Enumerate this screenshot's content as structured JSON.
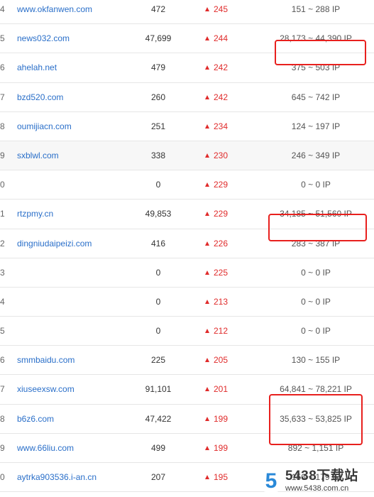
{
  "rows": [
    {
      "rank": "4",
      "domain": "www.okfanwen.com",
      "count": "472",
      "change": "245",
      "ip": "151 ~ 288 IP"
    },
    {
      "rank": "5",
      "domain": "news032.com",
      "count": "47,699",
      "change": "244",
      "ip": "28,173 ~ 44,390 IP"
    },
    {
      "rank": "6",
      "domain": "ahelah.net",
      "count": "479",
      "change": "242",
      "ip": "375 ~ 503 IP"
    },
    {
      "rank": "7",
      "domain": "bzd520.com",
      "count": "260",
      "change": "242",
      "ip": "645 ~ 742 IP"
    },
    {
      "rank": "8",
      "domain": "oumijiacn.com",
      "count": "251",
      "change": "234",
      "ip": "124 ~ 197 IP"
    },
    {
      "rank": "9",
      "domain": "sxblwl.com",
      "count": "338",
      "change": "230",
      "ip": "246 ~ 349 IP"
    },
    {
      "rank": "0",
      "domain": "",
      "count": "0",
      "change": "229",
      "ip": "0 ~ 0 IP"
    },
    {
      "rank": "1",
      "domain": "rtzpmy.cn",
      "count": "49,853",
      "change": "229",
      "ip": "34,185 ~ 51,560 IP"
    },
    {
      "rank": "2",
      "domain": "dingniudaipeizi.com",
      "count": "416",
      "change": "226",
      "ip": "283 ~ 387 IP"
    },
    {
      "rank": "3",
      "domain": "",
      "count": "0",
      "change": "225",
      "ip": "0 ~ 0 IP"
    },
    {
      "rank": "4",
      "domain": "",
      "count": "0",
      "change": "213",
      "ip": "0 ~ 0 IP"
    },
    {
      "rank": "5",
      "domain": "",
      "count": "0",
      "change": "212",
      "ip": "0 ~ 0 IP"
    },
    {
      "rank": "6",
      "domain": "smmbaidu.com",
      "count": "225",
      "change": "205",
      "ip": "130 ~ 155 IP"
    },
    {
      "rank": "7",
      "domain": "xiuseexsw.com",
      "count": "91,101",
      "change": "201",
      "ip": "64,841 ~ 78,221 IP"
    },
    {
      "rank": "8",
      "domain": "b6z6.com",
      "count": "47,422",
      "change": "199",
      "ip": "35,633 ~ 53,825 IP"
    },
    {
      "rank": "9",
      "domain": "www.66liu.com",
      "count": "499",
      "change": "199",
      "ip": "892 ~ 1,151 IP"
    },
    {
      "rank": "0",
      "domain": "aytrka903536.i-an.cn",
      "count": "207",
      "change": "195",
      "ip": "156 ~ 179 IP"
    }
  ],
  "watermark": {
    "logo_char": "5",
    "title": "5438下载站",
    "url": "www.5438.com.cn"
  },
  "colors": {
    "link": "#2a6fc9",
    "change_up": "#e02b2b",
    "highlight_box": "#e8201e",
    "row_border": "#e6e6e6"
  },
  "icons": {
    "change_indicator": "up-triangle-icon"
  }
}
